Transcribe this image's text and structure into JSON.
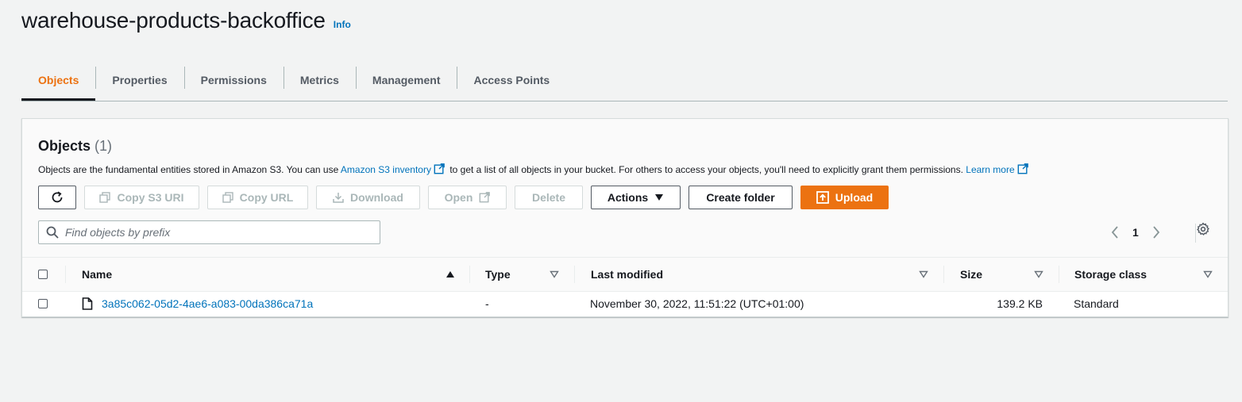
{
  "header": {
    "title": "warehouse-products-backoffice",
    "info": "Info"
  },
  "tabs": [
    {
      "label": "Objects",
      "active": true
    },
    {
      "label": "Properties"
    },
    {
      "label": "Permissions"
    },
    {
      "label": "Metrics"
    },
    {
      "label": "Management"
    },
    {
      "label": "Access Points"
    }
  ],
  "objects_panel": {
    "title": "Objects",
    "count": "(1)",
    "description": {
      "part1": "Objects are the fundamental entities stored in Amazon S3. You can use",
      "inventory_link": "Amazon S3 inventory",
      "part2": "to get a list of all objects in your bucket. For others to access your objects, you'll need to explicitly grant them permissions.",
      "learn_more": "Learn more"
    },
    "toolbar": {
      "copy_s3_uri": "Copy S3 URI",
      "copy_url": "Copy URL",
      "download": "Download",
      "open": "Open",
      "delete": "Delete",
      "actions": "Actions",
      "create_folder": "Create folder",
      "upload": "Upload"
    },
    "search": {
      "placeholder": "Find objects by prefix",
      "value": ""
    },
    "pagination": {
      "current_page": "1"
    }
  },
  "table": {
    "columns": {
      "name": "Name",
      "type": "Type",
      "last_modified": "Last modified",
      "size": "Size",
      "storage_class": "Storage class"
    },
    "rows": [
      {
        "name": "3a85c062-05d2-4ae6-a083-00da386ca71a",
        "type": "-",
        "last_modified": "November 30, 2022, 11:51:22 (UTC+01:00)",
        "size": "139.2 KB",
        "storage_class": "Standard"
      }
    ]
  },
  "colors": {
    "accent": "#ec7211",
    "link": "#0073bb",
    "text": "#16191f",
    "background": "#f2f3f3"
  },
  "icons": [
    "refresh-icon",
    "copy-icon",
    "download-icon",
    "external-link-icon",
    "caret-down-icon",
    "upload-icon",
    "search-icon",
    "chevron-left-icon",
    "chevron-right-icon",
    "gear-icon",
    "file-icon",
    "sort-ascending-icon",
    "sort-descending-icon"
  ]
}
